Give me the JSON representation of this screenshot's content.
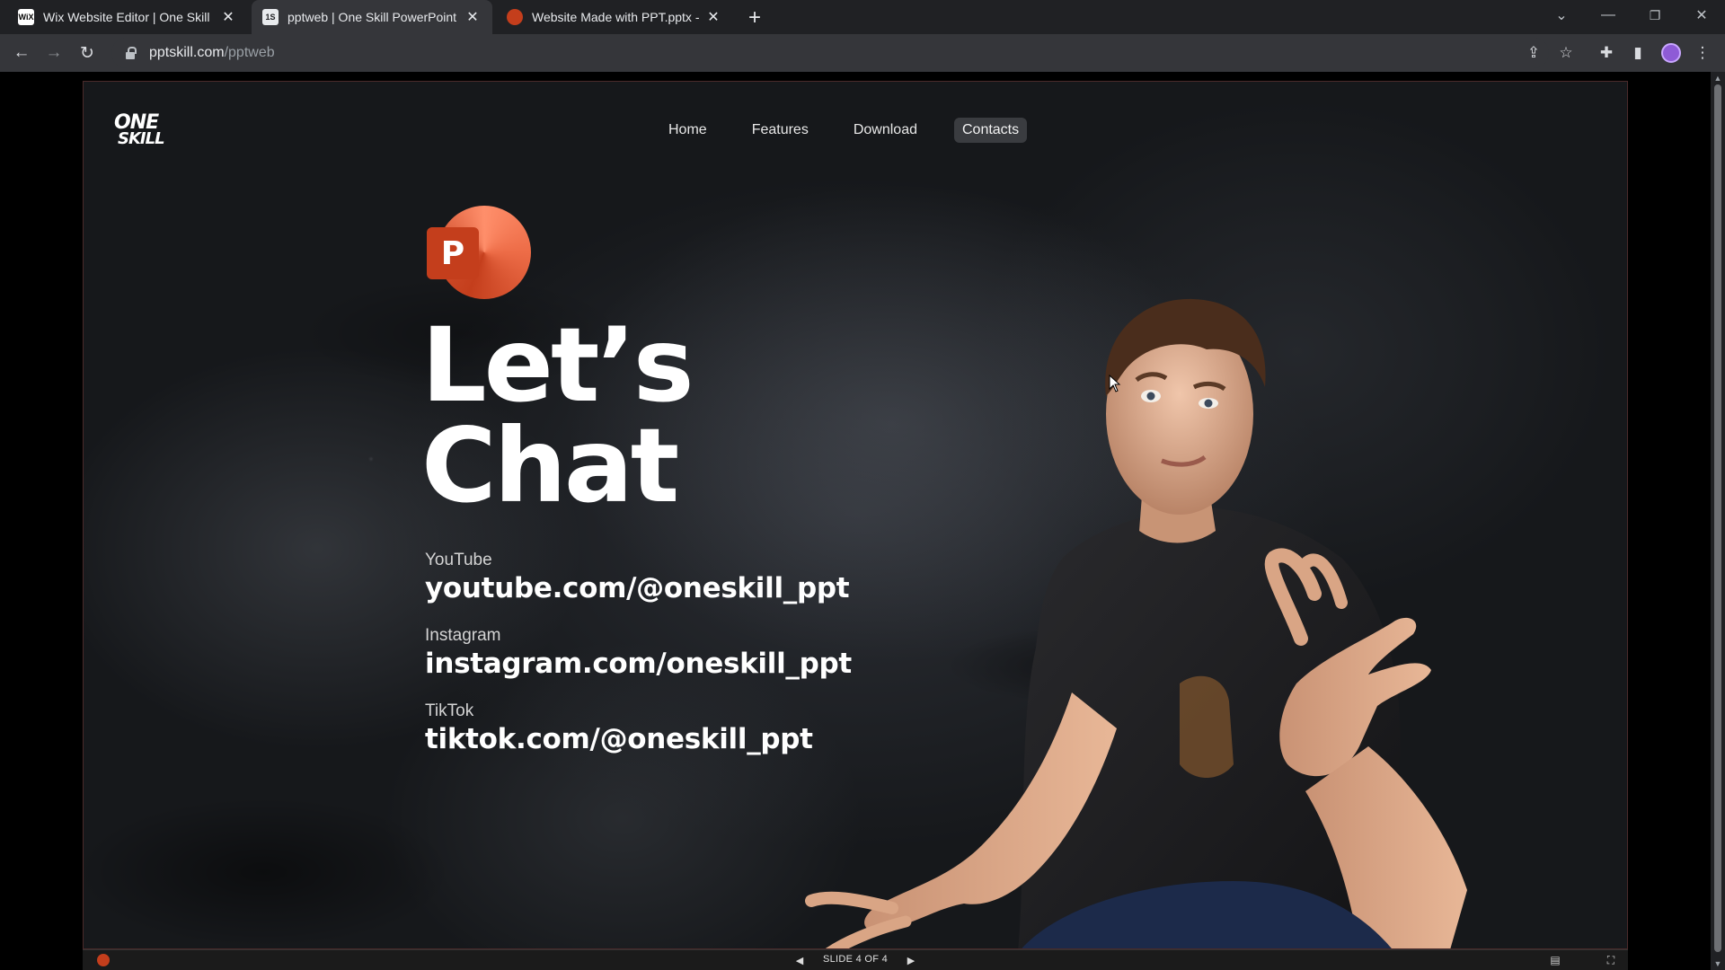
{
  "browser": {
    "tabs": [
      {
        "title": "Wix Website Editor | One Skill Po",
        "favicon_text": "WiX",
        "favicon_color": "#ffffff"
      },
      {
        "title": "pptweb | One Skill PowerPoint",
        "favicon_text": "1S",
        "favicon_color": "#35363a"
      },
      {
        "title": "Website Made with PPT.pptx - M",
        "favicon_text": "",
        "favicon_color": "#c43e1c"
      }
    ],
    "url_host": "pptskill.com",
    "url_path": "/pptweb",
    "icons": [
      "back-icon",
      "forward-icon",
      "reload-icon",
      "lock-icon",
      "share-icon",
      "star-icon",
      "extensions-icon",
      "sidepanel-icon",
      "profile-avatar",
      "menu-icon"
    ]
  },
  "slide": {
    "logo_line1": "ONE",
    "logo_line2": "SKILL",
    "nav": [
      "Home",
      "Features",
      "Download",
      "Contacts"
    ],
    "nav_active": "Contacts",
    "ppt_letter": "P",
    "headline_line1": "Let’s",
    "headline_line2": "Chat",
    "contacts": [
      {
        "label": "YouTube",
        "value": "youtube.com/@oneskill_ppt"
      },
      {
        "label": "Instagram",
        "value": "instagram.com/oneskill_ppt"
      },
      {
        "label": "TikTok",
        "value": "tiktok.com/@oneskill_ppt"
      }
    ],
    "accent_color": "#c43e1c"
  },
  "slideshow_bar": {
    "label": "SLIDE 4 OF 4"
  }
}
